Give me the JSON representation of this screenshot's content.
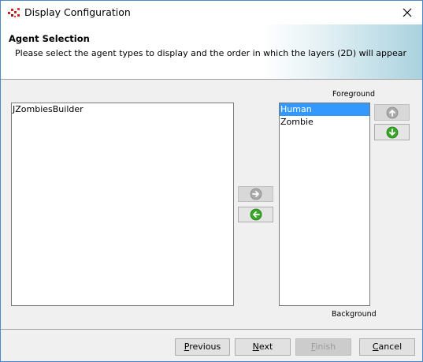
{
  "window": {
    "title": "Display Configuration"
  },
  "header": {
    "title": "Agent Selection",
    "description": "Please select the agent types to display and the order in which the layers (2D) will appear"
  },
  "available_list": {
    "items": [
      "JZombiesBuilder"
    ]
  },
  "layer_list": {
    "top_label": "Foreground",
    "bottom_label": "Background",
    "items": [
      {
        "label": "Human",
        "selected": true
      },
      {
        "label": "Zombie",
        "selected": false
      }
    ]
  },
  "icons": {
    "app": "repast-app-icon",
    "close": "close-icon",
    "add": "arrow-right-icon",
    "remove": "arrow-left-icon",
    "up": "arrow-up-icon",
    "down": "arrow-down-icon"
  },
  "colors": {
    "selection": "#3399ff",
    "arrow_active": "#3aa629",
    "arrow_disabled": "#a9a9a9"
  },
  "buttons": {
    "previous": {
      "mnemonic": "P",
      "rest": "revious",
      "enabled": true
    },
    "next": {
      "mnemonic": "N",
      "rest": "ext",
      "enabled": true
    },
    "finish": {
      "mnemonic": "F",
      "rest": "inish",
      "enabled": false
    },
    "cancel": {
      "mnemonic": "C",
      "rest": "ancel",
      "enabled": true
    }
  }
}
